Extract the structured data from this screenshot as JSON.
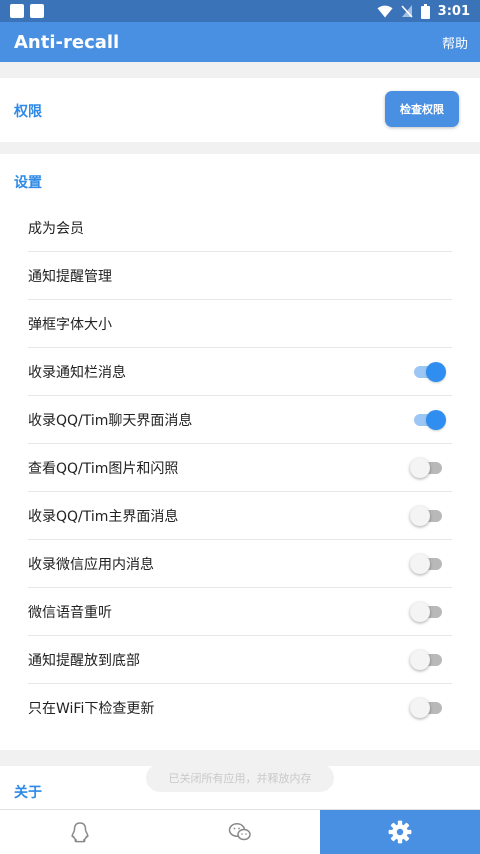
{
  "status_bar": {
    "time": "3:01",
    "icons": [
      "notification-square-icon",
      "notification-square-icon",
      "wifi-icon",
      "no-signal-icon",
      "battery-icon"
    ]
  },
  "app_bar": {
    "title": "Anti-recall",
    "help_label": "帮助"
  },
  "permissions": {
    "title": "权限",
    "check_button": "检查权限"
  },
  "settings": {
    "title": "设置",
    "items": [
      {
        "label": "成为会员"
      },
      {
        "label": "通知提醒管理"
      },
      {
        "label": "弹框字体大小"
      },
      {
        "label": "收录通知栏消息",
        "toggle": true
      },
      {
        "label": "收录QQ/Tim聊天界面消息",
        "toggle": true
      },
      {
        "label": "查看QQ/Tim图片和闪照",
        "toggle": false
      },
      {
        "label": "收录QQ/Tim主界面消息",
        "toggle": false
      },
      {
        "label": "收录微信应用内消息",
        "toggle": false
      },
      {
        "label": "微信语音重听",
        "toggle": false
      },
      {
        "label": "通知提醒放到底部",
        "toggle": false
      },
      {
        "label": "只在WiFi下检查更新",
        "toggle": false
      }
    ]
  },
  "about": {
    "title": "关于"
  },
  "toast": "已关闭所有应用，并释放内存",
  "bottom_nav": {
    "items": [
      {
        "icon": "qq-penguin-icon"
      },
      {
        "icon": "wechat-icon"
      },
      {
        "icon": "gear-icon",
        "active": true
      }
    ]
  },
  "colors": {
    "primary": "#4a90e2",
    "status_bar": "#3b73b8",
    "accent_text": "#2e8ae6",
    "toggle_on": "#2f8eef"
  }
}
